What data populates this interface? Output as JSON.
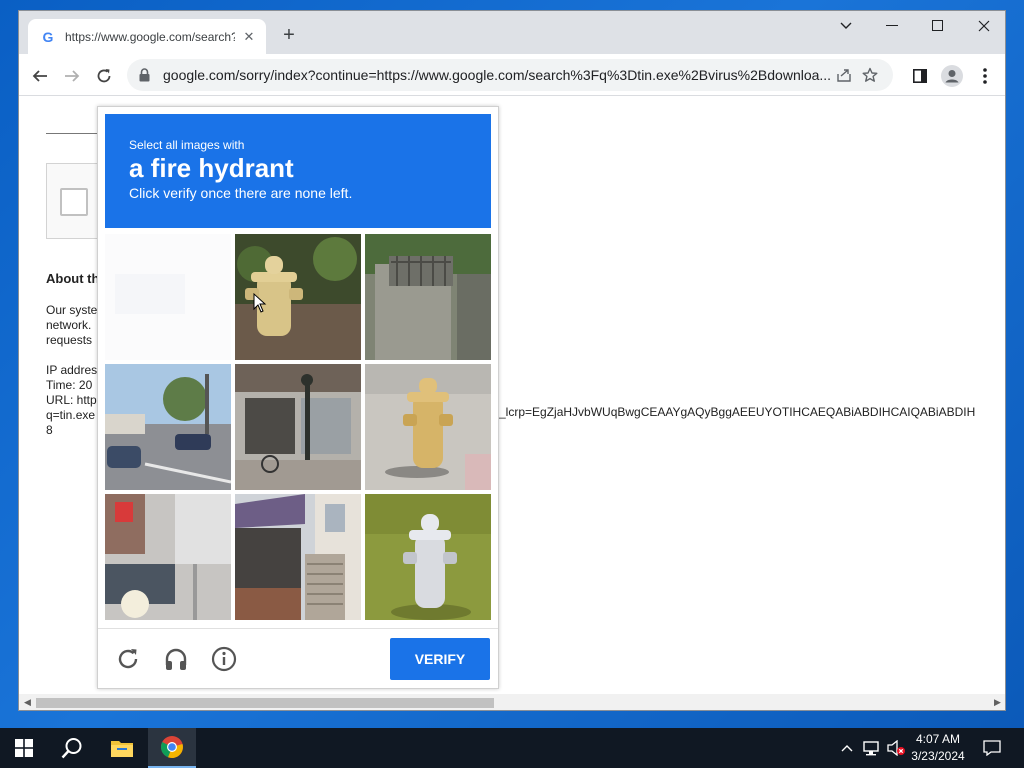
{
  "browser": {
    "tab_title": "https://www.google.com/search?q=",
    "tab_favicon": "G",
    "url": "google.com/sorry/index?continue=https://www.google.com/search%3Fq%3Dtin.exe%2Bvirus%2Bdownloa..."
  },
  "page": {
    "about_heading": "About th",
    "para_lines": [
      "Our syste",
      "network.",
      "requests"
    ],
    "info_lines": [
      "IP addres",
      "Time: 20",
      "URL: http",
      "q=tin.exe",
      "8"
    ],
    "overflow_text": "_lcrp=EgZjaHJvbWUqBwgCEAAYgAQyBggAEEUYOTIHCAEQABiABDIHCAIQABiABDIH"
  },
  "captcha": {
    "select_line": "Select all images with",
    "target": "a fire hydrant",
    "instruction": "Click verify once there are none left.",
    "verify_label": "VERIFY",
    "tiles": [
      "blank fading tile",
      "yellow fire hydrant among plants",
      "stone wall with iron fence",
      "street with parked cars",
      "shop storefront with lamp post",
      "yellow fire hydrant on sidewalk",
      "parking sign and street",
      "house porch with stairs",
      "white fire hydrant on grass"
    ]
  },
  "taskbar": {
    "time": "4:07 AM",
    "date": "3/23/2024"
  },
  "icons": {
    "reload": "refresh-icon",
    "audio": "headphones-icon",
    "info": "info-icon"
  },
  "colors": {
    "accent": "#1a73e8",
    "desktop": "#0a5fc4",
    "taskbar": "#101823"
  }
}
